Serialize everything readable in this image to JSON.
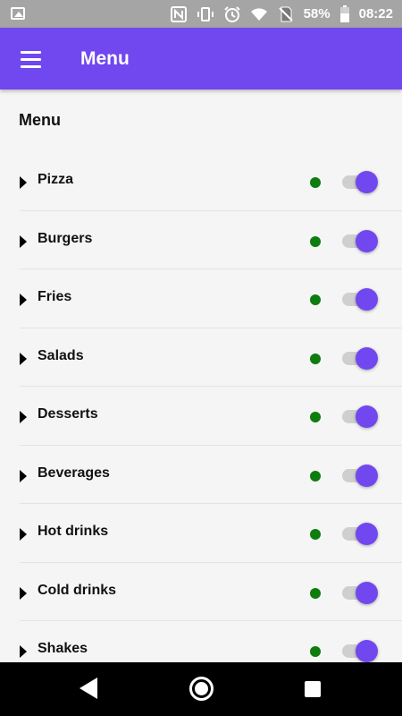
{
  "status_bar": {
    "battery": "58%",
    "time": "08:22",
    "icons": [
      "image-icon",
      "nfc-icon",
      "vibrate-icon",
      "alarm-icon",
      "wifi-icon",
      "no-sim-icon",
      "battery-icon"
    ]
  },
  "app_bar": {
    "title": "Menu",
    "menu_icon": "hamburger-menu-icon"
  },
  "content": {
    "section_title": "Menu",
    "items": [
      {
        "label": "Pizza",
        "status_color": "#0e7c0e",
        "enabled": true
      },
      {
        "label": "Burgers",
        "status_color": "#0e7c0e",
        "enabled": true
      },
      {
        "label": "Fries",
        "status_color": "#0e7c0e",
        "enabled": true
      },
      {
        "label": "Salads",
        "status_color": "#0e7c0e",
        "enabled": true
      },
      {
        "label": "Desserts",
        "status_color": "#0e7c0e",
        "enabled": true
      },
      {
        "label": "Beverages",
        "status_color": "#0e7c0e",
        "enabled": true
      },
      {
        "label": "Hot drinks",
        "status_color": "#0e7c0e",
        "enabled": true
      },
      {
        "label": "Cold drinks",
        "status_color": "#0e7c0e",
        "enabled": true
      },
      {
        "label": "Shakes",
        "status_color": "#0e7c0e",
        "enabled": true
      }
    ]
  },
  "theme": {
    "accent": "#7147f0",
    "status_bar_bg": "#a5a5a5",
    "background": "#f5f5f5"
  },
  "nav_bar": {
    "icons": [
      "back-icon",
      "home-icon",
      "recent-apps-icon"
    ]
  }
}
